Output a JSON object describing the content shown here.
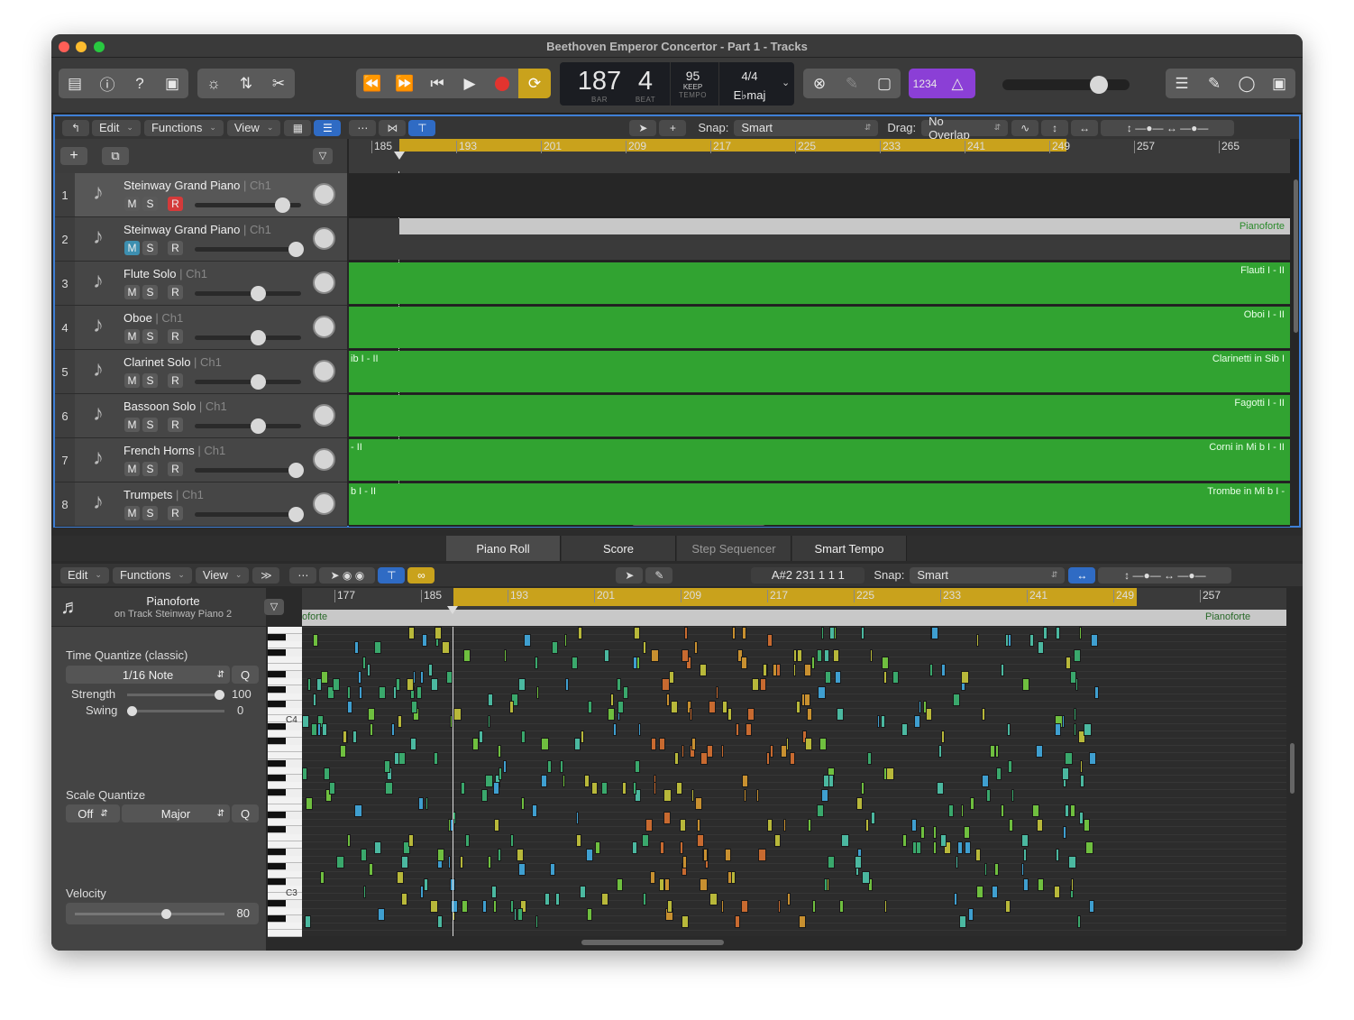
{
  "window": {
    "title": "Beethoven Emperor Concertor - Part 1 - Tracks"
  },
  "lcd": {
    "bar": "187",
    "beat": "4",
    "bar_label": "BAR",
    "beat_label": "BEAT",
    "tempo": "95",
    "keep": "KEEP",
    "tempo_label": "TEMPO",
    "signature": "4/4",
    "key": "E♭maj"
  },
  "count_in": "1234",
  "master_volume": 0.8,
  "tracks_bar": {
    "edit": "Edit",
    "functions": "Functions",
    "view": "View",
    "snap_label": "Snap:",
    "snap_value": "Smart",
    "drag_label": "Drag:",
    "drag_value": "No Overlap"
  },
  "ruler_top": [
    "185",
    "193",
    "201",
    "209",
    "217",
    "225",
    "233",
    "241",
    "249",
    "257",
    "265"
  ],
  "tracks": [
    {
      "num": "1",
      "name": "Steinway Grand Piano",
      "ch": "Ch1",
      "record": true,
      "mute_on": false,
      "volume": 0.83,
      "region": "",
      "region_left": ""
    },
    {
      "num": "2",
      "name": "Steinway Grand Piano",
      "ch": "Ch1",
      "record": false,
      "mute_on": true,
      "volume": 0.96,
      "region": "Pianoforte",
      "region_left": ""
    },
    {
      "num": "3",
      "name": "Flute Solo",
      "ch": "Ch1",
      "record": false,
      "mute_on": false,
      "volume": 0.6,
      "region": "Flauti I - II",
      "region_left": ""
    },
    {
      "num": "4",
      "name": "Oboe",
      "ch": "Ch1",
      "record": false,
      "mute_on": false,
      "volume": 0.6,
      "region": "Oboi I - II",
      "region_left": ""
    },
    {
      "num": "5",
      "name": "Clarinet Solo",
      "ch": "Ch1",
      "record": false,
      "mute_on": false,
      "volume": 0.6,
      "region": "Clarinetti in Sib I",
      "region_left": "ib I - II"
    },
    {
      "num": "6",
      "name": "Bassoon Solo",
      "ch": "Ch1",
      "record": false,
      "mute_on": false,
      "volume": 0.6,
      "region": "Fagotti I - II",
      "region_left": ""
    },
    {
      "num": "7",
      "name": "French Horns",
      "ch": "Ch1",
      "record": false,
      "mute_on": false,
      "volume": 0.96,
      "region": "Corni in Mi b I - II",
      "region_left": "- II"
    },
    {
      "num": "8",
      "name": "Trumpets",
      "ch": "Ch1",
      "record": false,
      "mute_on": false,
      "volume": 0.96,
      "region": "Trombe in Mi b I -",
      "region_left": "b I - II"
    }
  ],
  "msr": {
    "m": "M",
    "s": "S",
    "r": "R"
  },
  "lower_tabs": [
    "Piano Roll",
    "Score",
    "Step Sequencer",
    "Smart Tempo"
  ],
  "pr_bar": {
    "edit": "Edit",
    "functions": "Functions",
    "view": "View",
    "position": "A#2  231 1 1 1",
    "snap_label": "Snap:",
    "snap_value": "Smart"
  },
  "ruler_bottom": [
    "177",
    "185",
    "193",
    "201",
    "209",
    "217",
    "225",
    "233",
    "241",
    "249",
    "257"
  ],
  "region_name": {
    "title": "Pianoforte",
    "subtitle": "on Track Steinway Piano 2",
    "strip_left": "oforte",
    "strip_right": "Pianoforte"
  },
  "inspector": {
    "tq_title": "Time Quantize (classic)",
    "tq_value": "1/16 Note",
    "q": "Q",
    "strength_label": "Strength",
    "strength_value": "100",
    "swing_label": "Swing",
    "swing_value": "0",
    "sq_title": "Scale Quantize",
    "sq_off": "Off",
    "sq_scale": "Major",
    "vel_title": "Velocity",
    "vel_value": "80"
  },
  "keys": {
    "c4": "C4",
    "c3": "C3"
  }
}
